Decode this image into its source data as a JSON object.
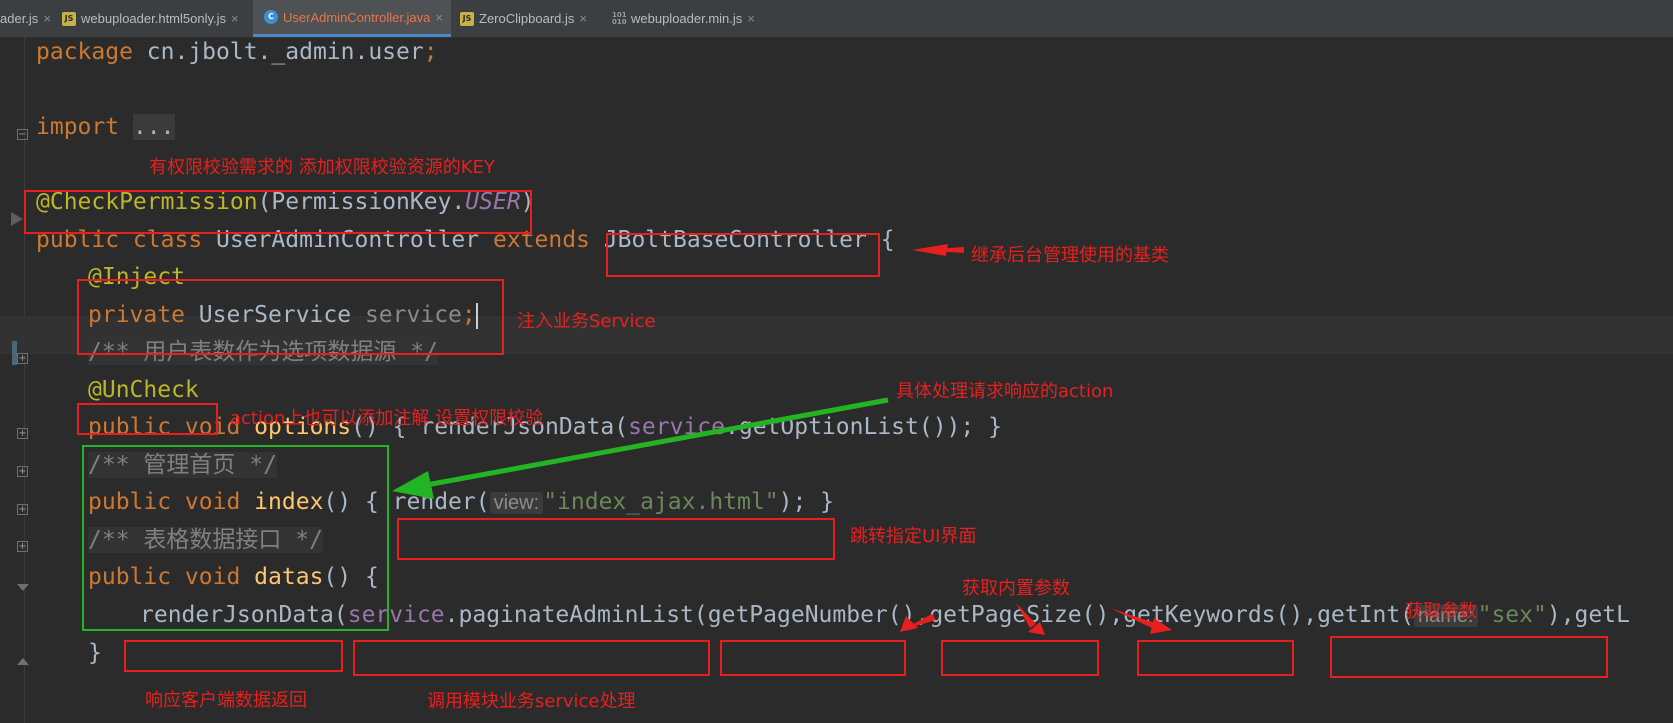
{
  "tabs": [
    {
      "label": "ader.js",
      "icon": "js-file-icon"
    },
    {
      "label": "webuploader.html5only.js",
      "icon": "js-file-icon"
    },
    {
      "label": "UserAdminController.java",
      "icon": "java-class-icon",
      "active": true
    },
    {
      "label": "ZeroClipboard.js",
      "icon": "js-file-icon"
    },
    {
      "label": "webuploader.min.js",
      "icon": "binary-file-icon"
    }
  ],
  "tab_close_glyph": "×",
  "code": {
    "package_kw": "package",
    "package_name": " cn.jbolt._admin.user",
    "semicolon": ";",
    "import_kw": "import",
    "import_fold": "...",
    "check_perm_ann": "@CheckPermission",
    "check_perm_open": "(PermissionKey.",
    "check_perm_field": "USER",
    "check_perm_close": ")",
    "class_mods": "public class",
    "class_name": " UserAdminController ",
    "extends_kw": "extends",
    "base_class": "JBoltBaseController",
    "brace_open": " {",
    "inject_ann": "@Inject",
    "private_kw": "private",
    "service_type": " UserService ",
    "service_var": "service",
    "comment_options": "/** 用户表数作为选项数据源 */",
    "uncheck_ann": "@UnCheck",
    "public_void": "public void",
    "options_fn": " options",
    "options_body_open": "() { renderJsonData(",
    "service_field": "service",
    "options_call": ".getOptionList()); }",
    "comment_index": "/** 管理首页 */",
    "index_fn": " index",
    "index_open": "() { ",
    "render_call": "render(",
    "hint_view": "view:",
    "index_str": "\"index_ajax.html\"",
    "render_close": "); }",
    "comment_datas": "/** 表格数据接口 */",
    "datas_fn": " datas",
    "datas_open": "() {",
    "render_json": "renderJsonData(",
    "paginate_call": ".paginateAdminList(",
    "get_page_number": "getPageNumber",
    "paren_comma": "(),",
    "get_page_size": "getPageSize",
    "get_keywords": "getKeywords",
    "get_int": "getInt(",
    "hint_name": "name:",
    "sex_str": "\"sex\"",
    "get_l": "),getL",
    "close_brace": "}"
  },
  "annotations": {
    "permission_key": "有权限校验需求的 添加权限校验资源的KEY",
    "base_controller": "继承后台管理使用的基类",
    "inject_service": "注入业务Service",
    "action_desc": "具体处理请求响应的action",
    "uncheck_desc": "action上也可以添加注解 设置权限校验",
    "render_ui": "跳转指定UI界面",
    "builtin_params": "获取内置参数",
    "get_param": "获取参数",
    "response_json": "响应客户端数据返回",
    "call_service": "调用模块业务service处理"
  },
  "colors": {
    "annotation_red": "#e6201f",
    "annotation_green": "#22b422",
    "editor_bg": "#2b2b2b"
  }
}
